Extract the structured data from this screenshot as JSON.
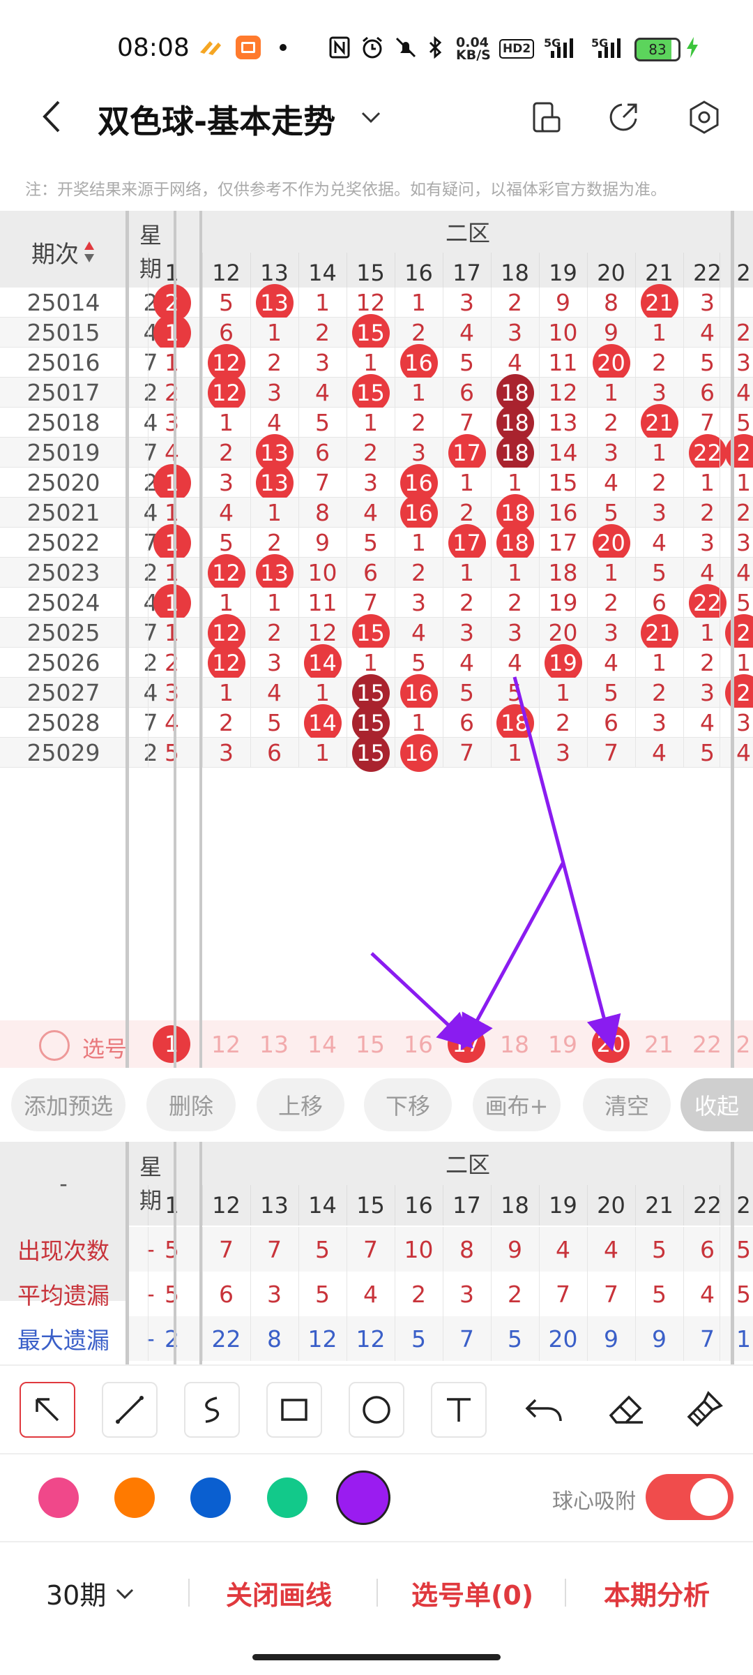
{
  "status_bar": {
    "time": "08:08",
    "net_speed": "0.04\nKB/S",
    "battery": "83",
    "net_5g_a": "5G",
    "net_5g_b": "5G",
    "hd": "HD2"
  },
  "header": {
    "title": "双色球-基本走势"
  },
  "notice": "注：开奖结果来源于网络，仅供参考不作为兑奖依据。如有疑问，以福体彩官方数据为准。",
  "table": {
    "period_header": "期次",
    "week_header": "星\n期",
    "zone_label": "二区",
    "numbers": [
      "1",
      "12",
      "13",
      "14",
      "15",
      "16",
      "17",
      "18",
      "19",
      "20",
      "21",
      "22",
      "2"
    ],
    "rows": [
      {
        "period": "25014",
        "week": "2",
        "cells": [
          "2",
          "5",
          "13",
          "1",
          "12",
          "1",
          "3",
          "2",
          "9",
          "8",
          "21",
          "3",
          ""
        ]
      },
      {
        "period": "25015",
        "week": "4",
        "cells": [
          "1",
          "6",
          "1",
          "2",
          "15",
          "2",
          "4",
          "3",
          "10",
          "9",
          "1",
          "4",
          "2"
        ]
      },
      {
        "period": "25016",
        "week": "7",
        "cells": [
          "1",
          "12",
          "2",
          "3",
          "1",
          "16",
          "5",
          "4",
          "11",
          "20",
          "2",
          "5",
          "3"
        ]
      },
      {
        "period": "25017",
        "week": "2",
        "cells": [
          "2",
          "12",
          "3",
          "4",
          "15",
          "1",
          "6",
          "18",
          "12",
          "1",
          "3",
          "6",
          "4"
        ]
      },
      {
        "period": "25018",
        "week": "4",
        "cells": [
          "3",
          "1",
          "4",
          "5",
          "1",
          "2",
          "7",
          "18",
          "13",
          "2",
          "21",
          "7",
          "5"
        ]
      },
      {
        "period": "25019",
        "week": "7",
        "cells": [
          "4",
          "2",
          "13",
          "6",
          "2",
          "3",
          "17",
          "18",
          "14",
          "3",
          "1",
          "22",
          "2"
        ]
      },
      {
        "period": "25020",
        "week": "2",
        "cells": [
          "1",
          "3",
          "13",
          "7",
          "3",
          "16",
          "1",
          "1",
          "15",
          "4",
          "2",
          "1",
          "1"
        ]
      },
      {
        "period": "25021",
        "week": "4",
        "cells": [
          "1",
          "4",
          "1",
          "8",
          "4",
          "16",
          "2",
          "18",
          "16",
          "5",
          "3",
          "2",
          "2"
        ]
      },
      {
        "period": "25022",
        "week": "7",
        "cells": [
          "1",
          "5",
          "2",
          "9",
          "5",
          "1",
          "17",
          "18",
          "17",
          "20",
          "4",
          "3",
          "3"
        ]
      },
      {
        "period": "25023",
        "week": "2",
        "cells": [
          "1",
          "12",
          "13",
          "10",
          "6",
          "2",
          "1",
          "1",
          "18",
          "1",
          "5",
          "4",
          "4"
        ]
      },
      {
        "period": "25024",
        "week": "4",
        "cells": [
          "1",
          "1",
          "1",
          "11",
          "7",
          "3",
          "2",
          "2",
          "19",
          "2",
          "6",
          "22",
          "5"
        ]
      },
      {
        "period": "25025",
        "week": "7",
        "cells": [
          "1",
          "12",
          "2",
          "12",
          "15",
          "4",
          "3",
          "3",
          "20",
          "3",
          "21",
          "1",
          "2"
        ]
      },
      {
        "period": "25026",
        "week": "2",
        "cells": [
          "2",
          "12",
          "3",
          "14",
          "1",
          "5",
          "4",
          "4",
          "19",
          "4",
          "1",
          "2",
          "1"
        ]
      },
      {
        "period": "25027",
        "week": "4",
        "cells": [
          "3",
          "1",
          "4",
          "1",
          "15",
          "16",
          "5",
          "5",
          "1",
          "5",
          "2",
          "3",
          "2"
        ]
      },
      {
        "period": "25028",
        "week": "7",
        "cells": [
          "4",
          "2",
          "5",
          "14",
          "15",
          "1",
          "6",
          "18",
          "2",
          "6",
          "3",
          "4",
          "3"
        ]
      },
      {
        "period": "25029",
        "week": "2",
        "cells": [
          "5",
          "3",
          "6",
          "1",
          "15",
          "16",
          "7",
          "1",
          "3",
          "7",
          "4",
          "5",
          "4"
        ]
      }
    ],
    "select_label": "选号",
    "select_row": [
      "1",
      "12",
      "13",
      "14",
      "15",
      "16",
      "17",
      "18",
      "19",
      "20",
      "21",
      "22",
      "2"
    ]
  },
  "actions": [
    "添加预选",
    "删除",
    "上移",
    "下移",
    "画布+",
    "清空",
    "收起"
  ],
  "stats": {
    "dash": "-",
    "week_header": "星\n期",
    "zone_label": "二区",
    "numbers": [
      "1",
      "12",
      "13",
      "14",
      "15",
      "16",
      "17",
      "18",
      "19",
      "20",
      "21",
      "22",
      "2"
    ],
    "rows": [
      {
        "label": "出现次数",
        "week": "-",
        "color": "#c8333a",
        "cells": [
          "5",
          "7",
          "7",
          "5",
          "7",
          "10",
          "8",
          "9",
          "4",
          "4",
          "5",
          "6",
          "5"
        ]
      },
      {
        "label": "平均遗漏",
        "week": "-",
        "color": "#c8333a",
        "cells": [
          "5",
          "6",
          "3",
          "5",
          "4",
          "2",
          "3",
          "2",
          "7",
          "7",
          "5",
          "4",
          "5"
        ]
      },
      {
        "label": "最大遗漏",
        "week": "-",
        "color": "#3a5fc8",
        "cells": [
          "2",
          "22",
          "8",
          "12",
          "12",
          "5",
          "7",
          "5",
          "20",
          "9",
          "9",
          "7",
          "1"
        ]
      }
    ]
  },
  "palette": {
    "colors": [
      "#f0488a",
      "#ff7a00",
      "#0a5fd0",
      "#12c98a",
      "#9a1cf0"
    ],
    "selected": "#9a1cf0",
    "snap_label": "球心吸附",
    "snap_on": true
  },
  "bottom": {
    "periods": "30期",
    "close_lines": "关闭画线",
    "pick_list": "选号单(0)",
    "analysis": "本期分析"
  }
}
